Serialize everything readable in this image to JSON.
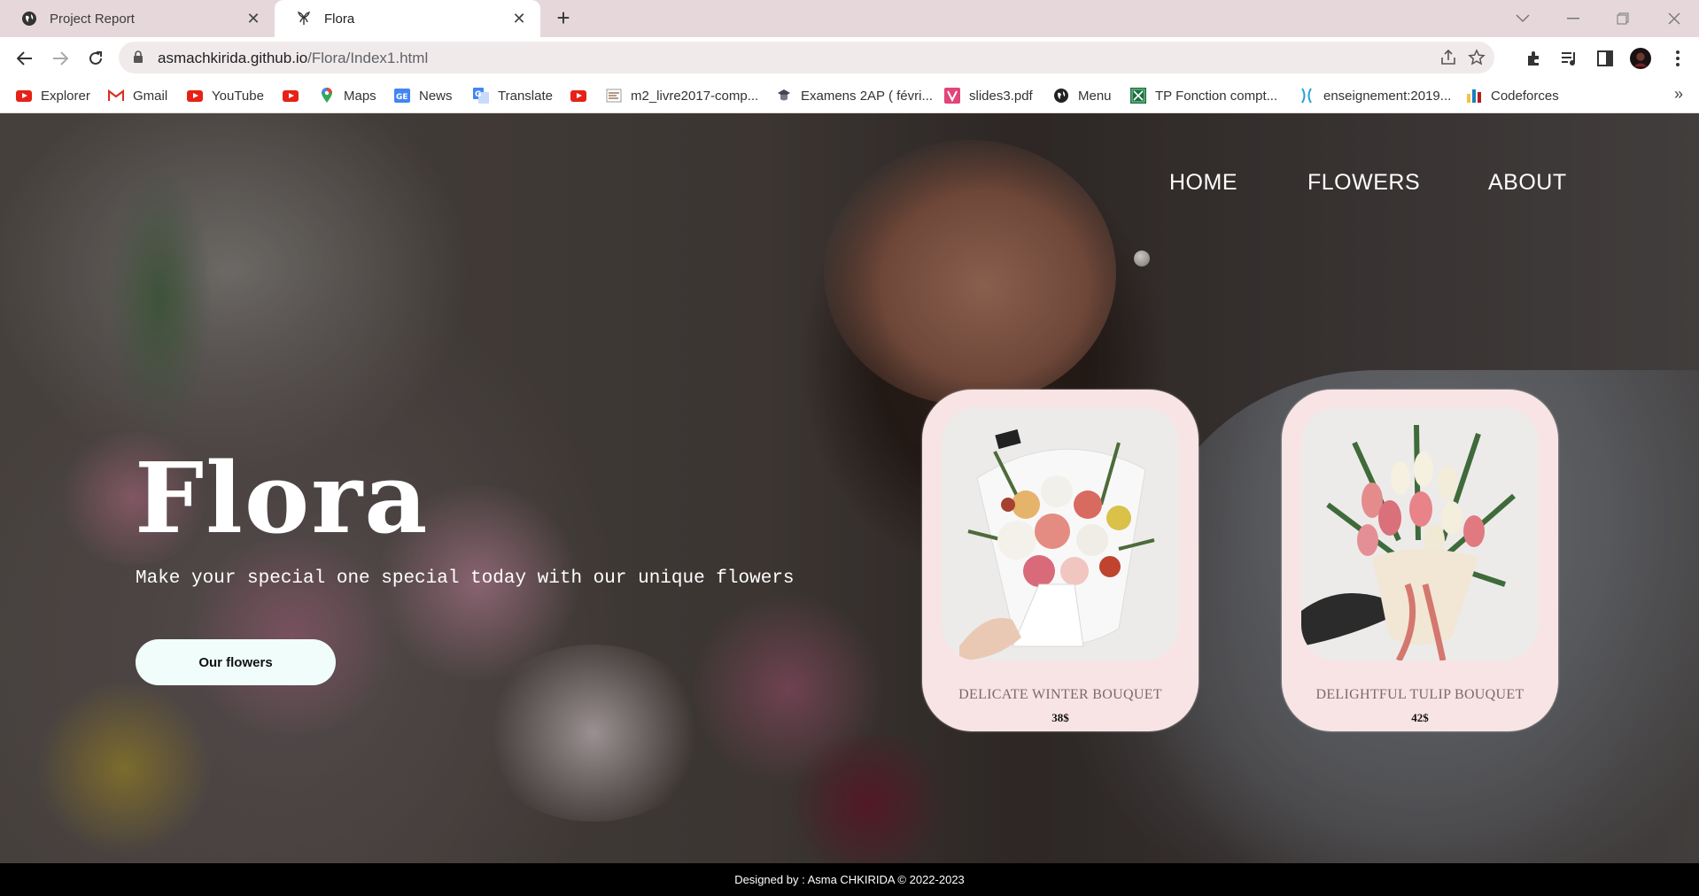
{
  "browser": {
    "tabs": [
      {
        "title": "Project Report",
        "icon": "globe-icon",
        "active": false
      },
      {
        "title": "Flora",
        "icon": "flower-icon",
        "active": true
      }
    ],
    "url_host": "asmachkirida.github.io",
    "url_path": "/Flora/Index1.html",
    "bookmarks": [
      {
        "label": "Explorer",
        "icon": "youtube-icon"
      },
      {
        "label": "Gmail",
        "icon": "gmail-icon"
      },
      {
        "label": "YouTube",
        "icon": "youtube-icon"
      },
      {
        "label": "",
        "icon": "youtube-icon"
      },
      {
        "label": "Maps",
        "icon": "maps-icon"
      },
      {
        "label": "News",
        "icon": "news-icon"
      },
      {
        "label": "Translate",
        "icon": "translate-icon"
      },
      {
        "label": "",
        "icon": "youtube-icon"
      },
      {
        "label": "m2_livre2017-comp...",
        "icon": "document-icon"
      },
      {
        "label": "Examens 2AP ( févri...",
        "icon": "school-icon"
      },
      {
        "label": "slides3.pdf",
        "icon": "pdf-icon"
      },
      {
        "label": "Menu",
        "icon": "globe-icon"
      },
      {
        "label": "TP Fonction compt...",
        "icon": "excel-icon"
      },
      {
        "label": "enseignement:2019...",
        "icon": "wiki-icon"
      },
      {
        "label": "Codeforces",
        "icon": "codeforces-icon"
      }
    ],
    "colors": {
      "tabstrip": "#e6d8da",
      "omnibox": "#f1eaeb"
    }
  },
  "site": {
    "nav": {
      "home": "HOME",
      "flowers": "FLOWERS",
      "about": "ABOUT"
    },
    "hero": {
      "title": "Flora",
      "subtitle": "Make your special one special today with our unique flowers",
      "cta": "Our flowers"
    },
    "products": [
      {
        "name": "DELICATE WINTER BOUQUET",
        "price": "38$"
      },
      {
        "name": "DELIGHTFUL TULIP BOUQUET",
        "price": "42$"
      }
    ],
    "footer": "Designed by : Asma CHKIRIDA © 2022-2023",
    "colors": {
      "card": "#f8e4e4",
      "cta": "#f0fdfb",
      "footer": "#000000"
    }
  }
}
